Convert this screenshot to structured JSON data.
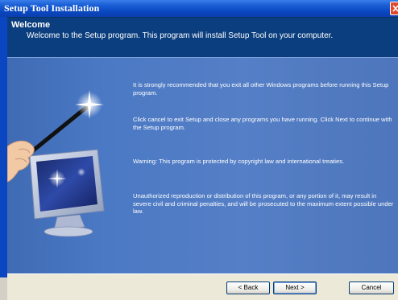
{
  "window": {
    "title": "Setup Tool Installation"
  },
  "header": {
    "title": "Welcome",
    "subtitle": "Welcome to the Setup program. This program will install Setup Tool on your computer."
  },
  "body": {
    "paragraphs": [
      "It is strongly recommended that you exit all other Windows programs before running this Setup program.",
      "Click cancel to exit Setup and close any programs you have running. Click Next to continue with the Setup program.",
      "Warning: This program is protected by copyright law and international treaties.",
      "Unauthorized reproduction or distribution of this program, or any portion of it, may result in severe civil and criminal penalties, and will be prosecuted to the maximum extent possible under law."
    ]
  },
  "buttons": {
    "back": "< Back",
    "next": "Next >",
    "cancel": "Cancel"
  },
  "icons": {
    "close": "close-icon",
    "illustration": "magic-wand-monitor-icon"
  },
  "colors": {
    "titlebar": "#0a46c0",
    "header": "#0b3e7e",
    "panel": "#4b79c4",
    "close": "#e0482c"
  }
}
